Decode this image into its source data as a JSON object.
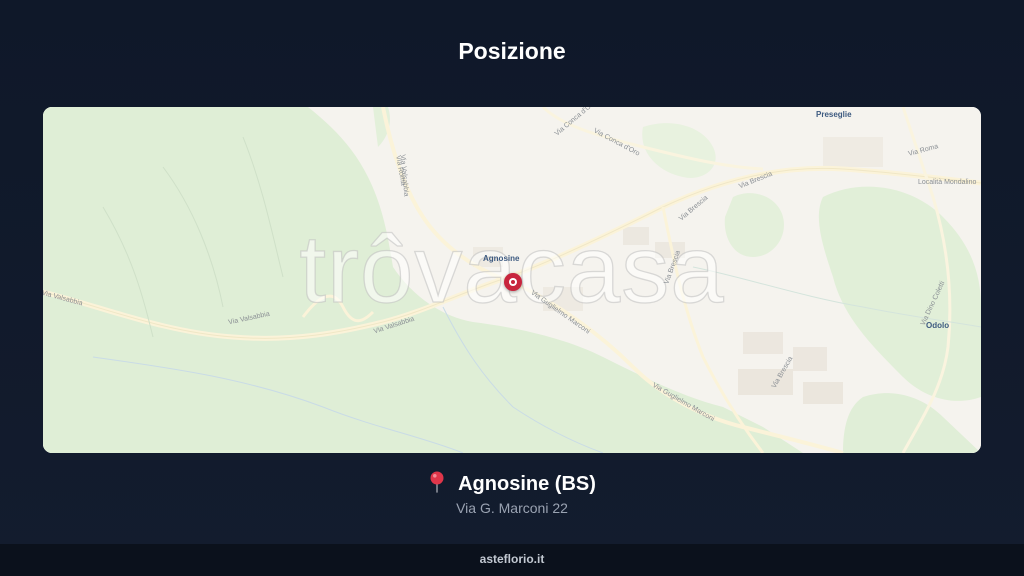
{
  "page": {
    "title": "Posizione"
  },
  "map": {
    "watermark": "trôvacasa",
    "marker_icon": "map-pin-marker-icon",
    "labels": {
      "agnosine": "Agnosine",
      "preseglie": "Preseglie",
      "odolo": "Odolo",
      "via_roma_1": "Via Roma",
      "via_roma_2": "Via Roma",
      "via_valsabbia_1": "Via Valsabbia",
      "via_valsabbia_2": "Via Valsabbia",
      "via_valsabbia_3": "Via Valsabbia",
      "via_valsabbia_4": "Via Valsabbia",
      "via_brescia_1": "Via Brescia",
      "via_brescia_2": "Via Brescia",
      "via_brescia_3": "Via Brescia",
      "via_brescia_4": "Via Brescia",
      "via_conca_doro_1": "Via Conca d'Oro",
      "via_conca_doro_2": "Via Conca d'Oro",
      "localita_mondalino": "Località Mondalino",
      "via_marconi_1": "Via Guglielmo Marconi",
      "via_marconi_2": "Via Guglielmo Marconi",
      "via_dino_coletti": "Via Dino Coletti"
    },
    "colors": {
      "forest": "#dfeed6",
      "urban": "#f6f3ee",
      "road": "#fbf6e4",
      "marker": "#c8253d"
    }
  },
  "location": {
    "icon": "round-pushpin-icon",
    "name": "Agnosine (BS)",
    "address": "Via G. Marconi 22"
  },
  "footer": {
    "site": "asteflorio.it"
  }
}
